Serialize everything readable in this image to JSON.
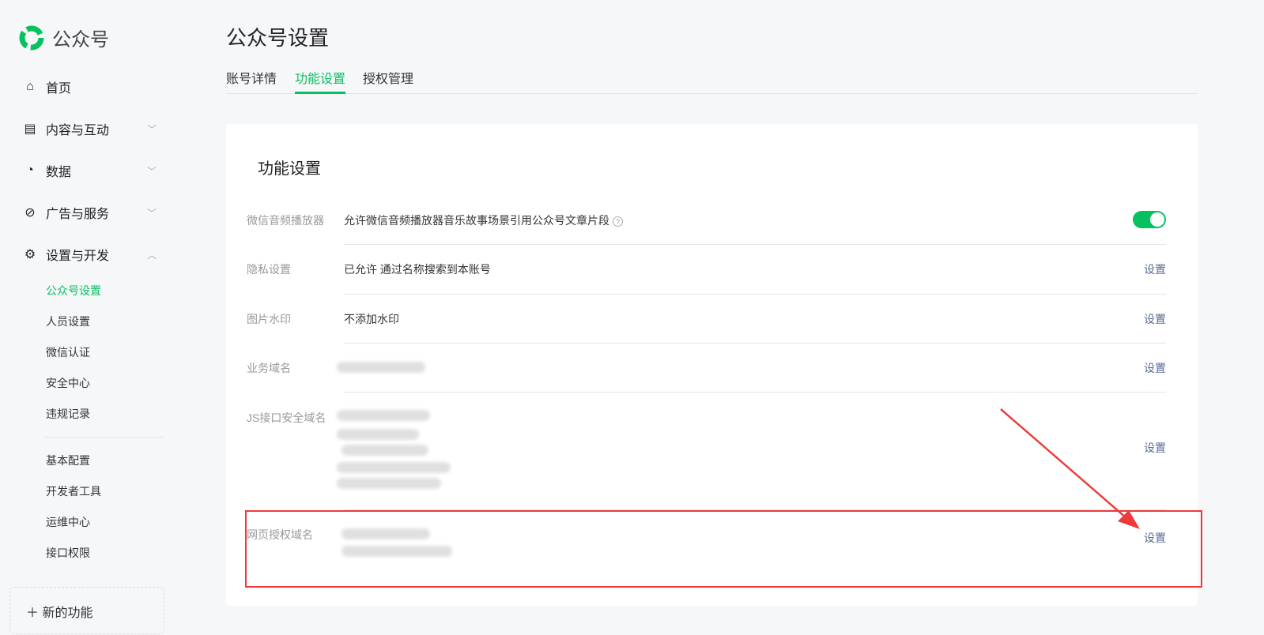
{
  "sidebar": {
    "logo": "公众号",
    "nav": [
      {
        "label": "首页",
        "icon": "home-icon"
      },
      {
        "label": "内容与互动",
        "icon": "document-icon"
      },
      {
        "label": "数据",
        "icon": "pie-chart-icon"
      },
      {
        "label": "广告与服务",
        "icon": "compass-icon"
      },
      {
        "label": "设置与开发",
        "icon": "gear-icon"
      }
    ],
    "sub": [
      "公众号设置",
      "人员设置",
      "微信认证",
      "安全中心",
      "违规记录",
      "基本配置",
      "开发者工具",
      "运维中心",
      "接口权限"
    ],
    "new_feature": "新的功能"
  },
  "page_title": "公众号设置",
  "tabs": [
    "账号详情",
    "功能设置",
    "授权管理"
  ],
  "card": {
    "title": "功能设置",
    "rows": [
      {
        "label": "微信音频播放器",
        "value": "允许微信音频播放器音乐故事场景引用公众号文章片段",
        "toggle_on": true
      },
      {
        "label": "隐私设置",
        "value": "已允许 通过名称搜索到本账号",
        "action": "设置"
      },
      {
        "label": "图片水印",
        "value": "不添加水印",
        "action": "设置"
      },
      {
        "label": "业务域名",
        "action": "设置"
      },
      {
        "label": "JS接口安全域名",
        "action": "设置"
      },
      {
        "label": "网页授权域名",
        "action": "设置"
      }
    ]
  },
  "colors": {
    "accent": "#07c160",
    "link": "#576b95",
    "annotation": "#f03a3a"
  }
}
